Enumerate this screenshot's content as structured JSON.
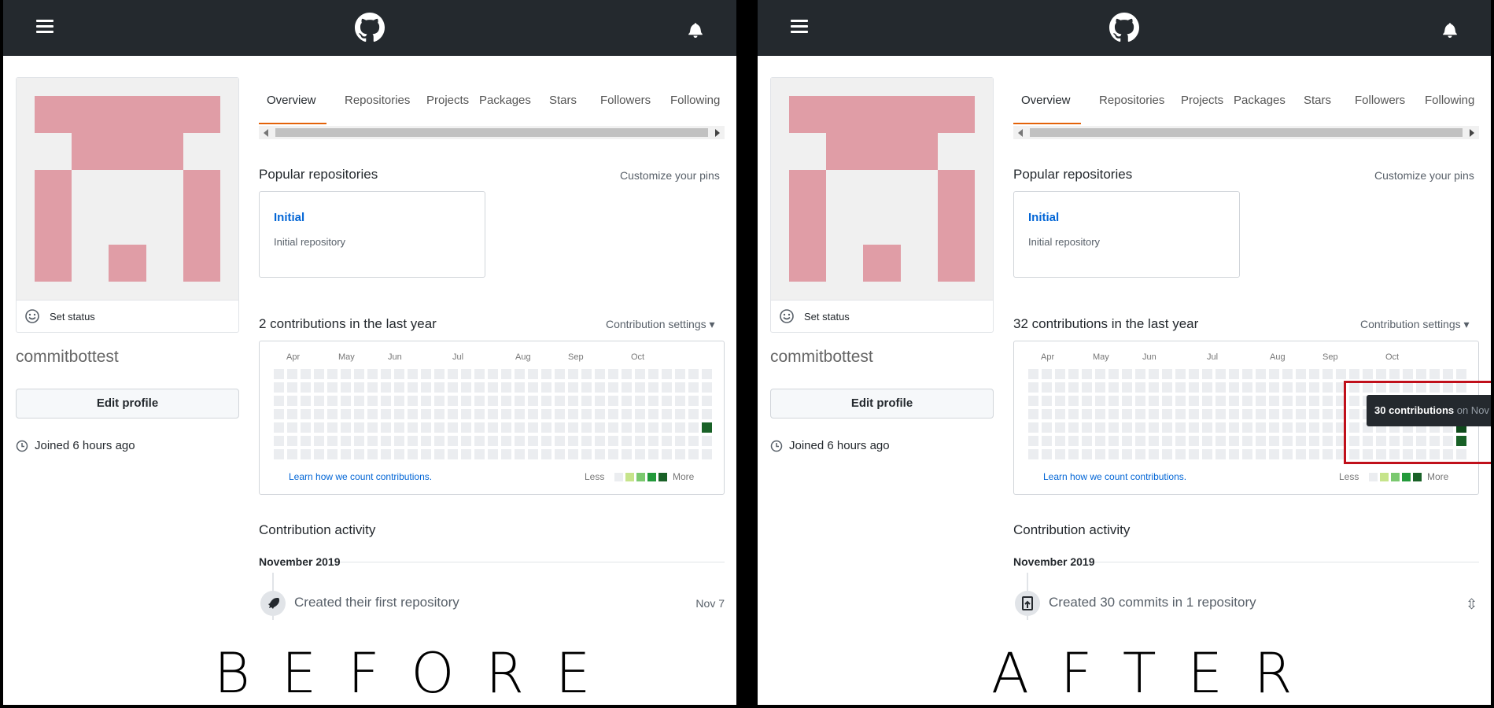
{
  "panels": [
    {
      "key": "before",
      "caption": "BEFORE",
      "tabs": [
        "Overview",
        "Repositories",
        "Projects",
        "Packages",
        "Stars",
        "Followers",
        "Following"
      ],
      "status_text": "Set status",
      "username": "commitbottest",
      "edit_profile": "Edit profile",
      "joined": "Joined 6 hours ago",
      "popular_title": "Popular repositories",
      "customize_pins": "Customize your pins",
      "pin_name": "Initial",
      "pin_desc": "Initial repository",
      "contrib_title": "2 contributions in the last year",
      "contrib_settings": "Contribution settings ▾",
      "months": [
        "Apr",
        "May",
        "Jun",
        "Jul",
        "Aug",
        "Sep",
        "Oct"
      ],
      "learn_link": "Learn how we count contributions.",
      "legend_less": "Less",
      "legend_more": "More",
      "activity_title": "Contribution activity",
      "activity_month": "November 2019",
      "activity_text": "Created their first repository",
      "activity_date": "Nov 7",
      "activity_icon": "rocket-icon",
      "filled_cells": [
        {
          "week": 32,
          "day": 4,
          "level": 4
        }
      ]
    },
    {
      "key": "after",
      "caption": "AFTER",
      "tabs": [
        "Overview",
        "Repositories",
        "Projects",
        "Packages",
        "Stars",
        "Followers",
        "Following"
      ],
      "status_text": "Set status",
      "username": "commitbottest",
      "edit_profile": "Edit profile",
      "joined": "Joined 6 hours ago",
      "popular_title": "Popular repositories",
      "customize_pins": "Customize your pins",
      "pin_name": "Initial",
      "pin_desc": "Initial repository",
      "contrib_title": "32 contributions in the last year",
      "contrib_settings": "Contribution settings ▾",
      "months": [
        "Apr",
        "May",
        "Jun",
        "Jul",
        "Aug",
        "Sep",
        "Oct"
      ],
      "learn_link": "Learn how we count contributions.",
      "legend_less": "Less",
      "legend_more": "More",
      "activity_title": "Contribution activity",
      "activity_month": "November 2019",
      "activity_text": "Created 30 commits in 1 repository",
      "activity_date": "",
      "activity_icon": "repo-push-icon",
      "tooltip_bold": "30 contributions",
      "tooltip_rest": " on Nov",
      "filled_cells": [
        {
          "week": 32,
          "day": 4,
          "level": 5
        },
        {
          "week": 32,
          "day": 5,
          "level": 4
        }
      ]
    }
  ],
  "colors": {
    "topbar": "#24292e",
    "avatar_pink": "#e09da6",
    "avatar_bg": "#f0f0f0",
    "accent_tab": "#e36209",
    "link": "#0366d6",
    "legend": [
      "#ebedf0",
      "#c6e48b",
      "#7bc96f",
      "#239a3b",
      "#196127"
    ],
    "highlight": "#c0101b"
  }
}
